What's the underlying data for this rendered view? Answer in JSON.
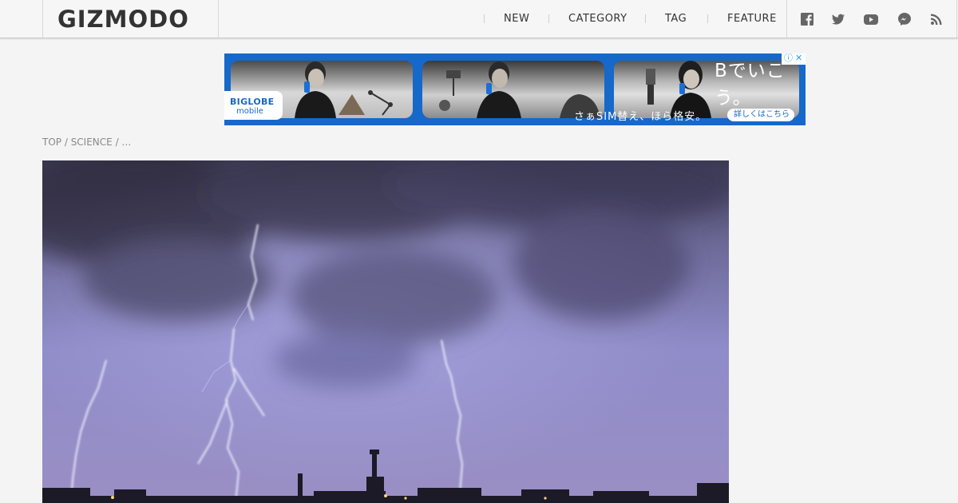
{
  "header": {
    "logo": "GIZMODO",
    "nav": [
      {
        "label": "NEW"
      },
      {
        "label": "CATEGORY"
      },
      {
        "label": "TAG"
      },
      {
        "label": "FEATURE"
      }
    ],
    "social_icons": [
      "facebook-icon",
      "twitter-icon",
      "youtube-icon",
      "messenger-icon",
      "rss-icon"
    ]
  },
  "ad": {
    "brand": "BIGLOBE",
    "brand_sub": "mobile",
    "headline": "Bでいこう。",
    "subline": "さぁSIM替え、ほら格安。",
    "cta": "詳しくはこちら ▶",
    "adchoice_info": "ⓘ",
    "adchoice_close": "✕",
    "colors": {
      "background": "#1668c9"
    }
  },
  "breadcrumb": {
    "items": [
      "TOP",
      "SCIENCE",
      "…"
    ],
    "separator": " / "
  },
  "hero": {
    "image": "lightning-storm-over-city"
  }
}
